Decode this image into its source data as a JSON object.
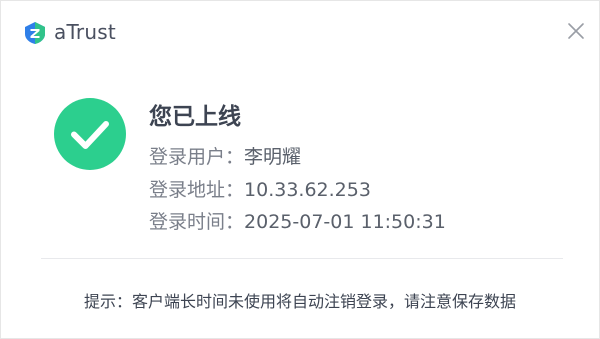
{
  "window": {
    "app_title": "aTrust",
    "logo_icon": "atrust-logo-icon",
    "close_icon": "close-icon"
  },
  "status": {
    "icon": "check-circle-icon",
    "icon_color": "#2ccf8e",
    "title": "您已上线"
  },
  "info": {
    "user_label": "登录用户：",
    "user_value": "李明耀",
    "address_label": "登录地址：",
    "address_value": "10.33.62.253",
    "time_label": "登录时间：",
    "time_value": "2025-07-01 11:50:31"
  },
  "tip": "提示：客户端长时间未使用将自动注销登录，请注意保存数据",
  "colors": {
    "accent_green": "#2ccf8e",
    "logo_blue": "#2f7fe8",
    "logo_green": "#31c38a",
    "title_text": "#3d4452",
    "label_text": "#7a7f8a"
  }
}
